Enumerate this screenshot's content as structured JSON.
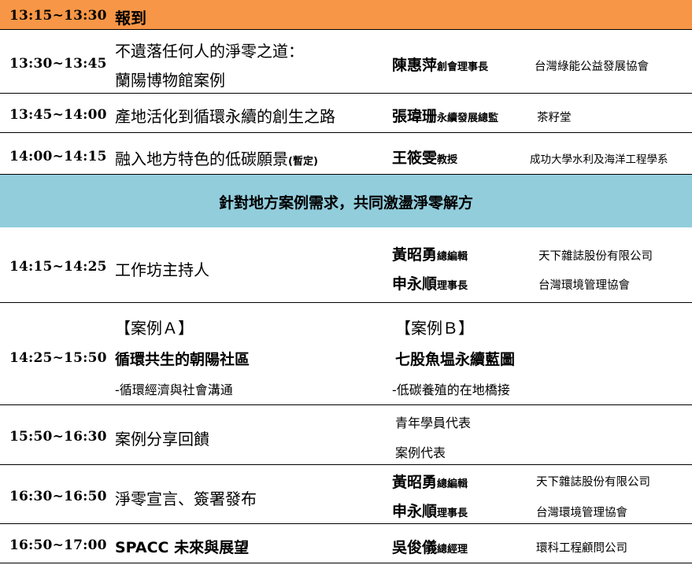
{
  "schedule": {
    "row1": {
      "time": "13:15~13:30",
      "title": "報到"
    },
    "row2": {
      "time": "13:30~13:45",
      "title_line1": "不遺落任何人的淨零之道：",
      "title_line2": "蘭陽博物館案例",
      "speaker": {
        "name": "陳惠萍",
        "role": "創會理事長",
        "org": "台灣綠能公益發展協會"
      }
    },
    "row3": {
      "time": "13:45~14:00",
      "title": "產地活化到循環永續的創生之路",
      "speaker": {
        "name": "張瑋珊",
        "role": "永續發展總監",
        "org": "茶籽堂"
      }
    },
    "row4": {
      "time": "14:00~14:15",
      "title": "融入地方特色的低碳願景",
      "title_note": "(暫定)",
      "speaker": {
        "name": "王筱雯",
        "role": "教授",
        "org": "成功大學水利及海洋工程學系"
      }
    },
    "section": {
      "title": "針對地方案例需求，共同激盪淨零解方"
    },
    "row5": {
      "time": "14:15~14:25",
      "title": "工作坊主持人",
      "speakers": [
        {
          "name": "黃昭勇",
          "role": "總編輯",
          "org": "天下雜誌股份有限公司"
        },
        {
          "name": "申永順",
          "role": "理事長",
          "org": "台灣環境管理協會"
        }
      ]
    },
    "row6": {
      "time": "14:25~15:50",
      "case_a": {
        "label": "【案例Ａ】",
        "title": "循環共生的朝陽社區",
        "sub": "-循環經濟與社會溝通"
      },
      "case_b": {
        "label": "【案例Ｂ】",
        "title": "七股魚塭永續藍圖",
        "sub": "-低碳養殖的在地橋接"
      }
    },
    "row7": {
      "time": "15:50~16:30",
      "title": "案例分享回饋",
      "items": [
        "青年學員代表",
        "案例代表"
      ]
    },
    "row8": {
      "time": "16:30~16:50",
      "title": "淨零宣言、簽署發布",
      "speakers": [
        {
          "name": "黃昭勇",
          "role": "總編輯",
          "org": "天下雜誌股份有限公司"
        },
        {
          "name": "申永順",
          "role": "理事長",
          "org": "台灣環境管理協會"
        }
      ]
    },
    "row9": {
      "time": "16:50~17:00",
      "title": "SPACC 未來與展望",
      "speaker": {
        "name": "吳俊儀",
        "role": "總經理",
        "org": "環科工程顧問公司"
      }
    }
  },
  "colors": {
    "banner": "#f79646",
    "section": "#92cddc",
    "rule": "#000000"
  }
}
